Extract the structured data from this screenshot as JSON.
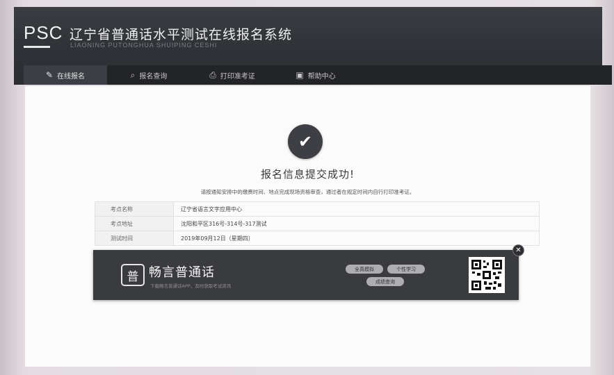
{
  "header": {
    "logo": "PSC",
    "title": "辽宁省普通话水平测试在线报名系统",
    "subtitle": "LIAONING PUTONGHUA SHUIPING CESHI"
  },
  "nav": {
    "items": [
      {
        "label": "在线报名",
        "icon": "edit-icon",
        "active": true
      },
      {
        "label": "报名查询",
        "icon": "search-icon",
        "active": false
      },
      {
        "label": "打印准考证",
        "icon": "printer-icon",
        "active": false
      },
      {
        "label": "帮助中心",
        "icon": "help-icon",
        "active": false
      }
    ]
  },
  "result": {
    "icon": "check-icon",
    "title": "报名信息提交成功!",
    "notice": "请按通知安排中的缴费时间、地点完成现场资格审查，通过者在规定时间内自行打印准考证。"
  },
  "info": {
    "rows": [
      {
        "key": "考点名称",
        "value": "辽宁省语言文字应用中心"
      },
      {
        "key": "考点地址",
        "value": "沈阳和平区316号-314号-317测试"
      },
      {
        "key": "测试时间",
        "value": "2019年09月12日（星期四）"
      }
    ]
  },
  "banner": {
    "app_icon": "普",
    "app_name": "畅言普通话",
    "app_sub": "下载畅言普通话APP，及时获取考试资讯",
    "buttons": [
      "全真模拟",
      "个性学习",
      "成绩查询"
    ],
    "qr_icon": "qr-code-icon",
    "close_icon": "close-icon"
  }
}
